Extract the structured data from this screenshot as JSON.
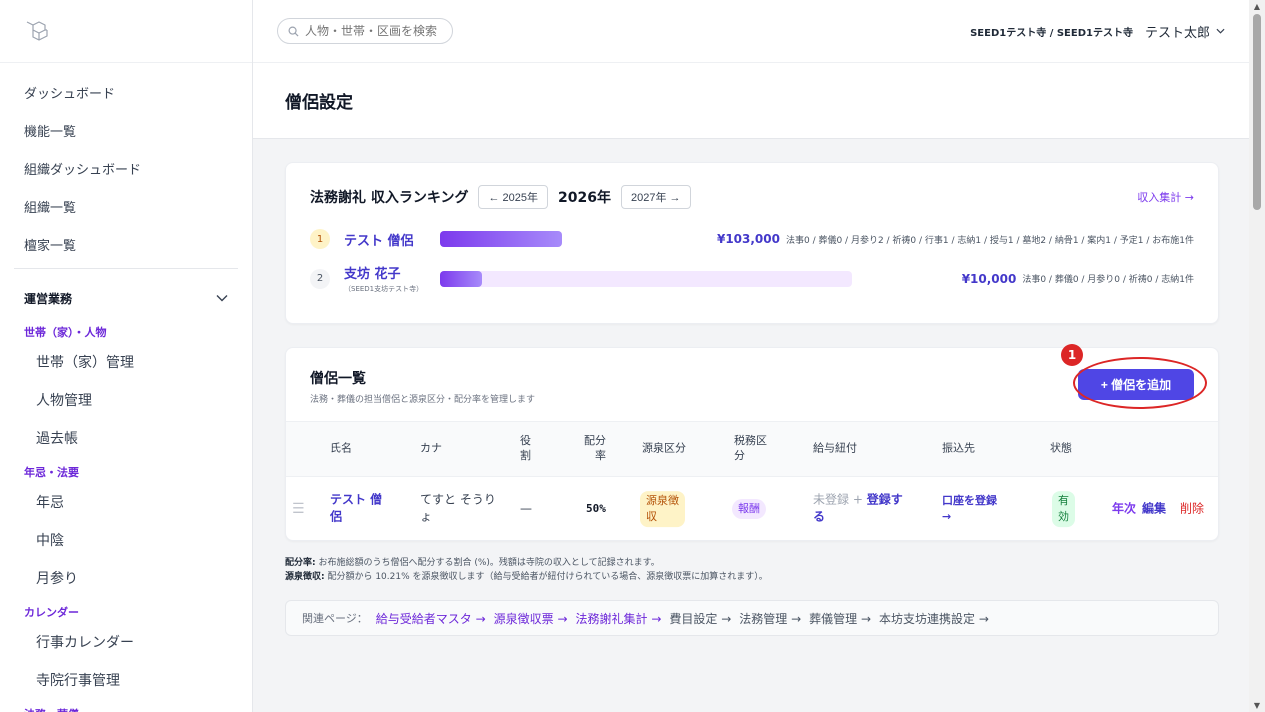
{
  "sidebar": {
    "nav": [
      "ダッシュボード",
      "機能一覧",
      "組織ダッシュボード",
      "組織一覧",
      "檀家一覧"
    ],
    "section": "運営業務",
    "groups": [
      {
        "title": "世帯（家）・人物",
        "items": [
          "世帯（家）管理",
          "人物管理",
          "過去帳"
        ]
      },
      {
        "title": "年忌・法要",
        "items": [
          "年忌",
          "中陰",
          "月参り"
        ]
      },
      {
        "title": "カレンダー",
        "items": [
          "行事カレンダー",
          "寺院行事管理"
        ]
      }
    ],
    "cut_group": "法務・葬儀"
  },
  "header": {
    "search_placeholder": "人物・世帯・区画を検索",
    "org": "SEED1テスト寺 / SEED1テスト寺",
    "user": "テスト太郎"
  },
  "page": {
    "title": "僧侶設定"
  },
  "ranking": {
    "title": "法務謝礼 収入ランキング",
    "prev_year": "← 2025年",
    "current_year": "2026年",
    "next_year": "2027年 →",
    "link": "収入集計 →",
    "rows": [
      {
        "rank": "1",
        "name": "テスト 僧侶",
        "sub": "",
        "amount": "¥103,000",
        "ratio": 1.0,
        "detail": "法事0 / 葬儀0 / 月参り2 / 祈祷0 / 行事1 / 志納1 / 授与1 / 墓地2 / 納骨1 / 案内1 / 予定1 / お布施1件"
      },
      {
        "rank": "2",
        "name": "支坊 花子",
        "sub": "（SEED1支坊テスト寺）",
        "amount": "¥10,000",
        "ratio": 0.097,
        "detail": "法事0 / 葬儀0 / 月参り0 / 祈祷0 / 志納1件"
      }
    ]
  },
  "list": {
    "title": "僧侶一覧",
    "subtitle": "法務・葬儀の担当僧侶と源泉区分・配分率を管理します",
    "add_button": "+ 僧侶を追加",
    "marker": "1",
    "headers": {
      "name": "氏名",
      "kana": "カナ",
      "role": "役\n割",
      "ratio": "配分\n率",
      "withholding": "源泉区分",
      "tax": "税務区\n分",
      "salary": "給与紐付",
      "bank": "振込先",
      "status": "状態"
    },
    "row": {
      "drag": "☰",
      "name": "テスト 僧\n侶",
      "kana": "てすと そうり\nょ",
      "role": "—",
      "ratio": "50%",
      "withholding": "源泉徴\n収",
      "tax": "報酬",
      "salary_status": "未登録",
      "salary_sep": " + ",
      "salary_link": "登録す\nる",
      "bank": "口座を登録\n→",
      "status": "有\n効",
      "action_annual": "年次",
      "action_edit": "編集",
      "action_delete": "削除"
    }
  },
  "notes": {
    "ratio_label": "配分率:",
    "ratio_text": " お布施総額のうち僧侶へ配分する割合 (%)。残額は寺院の収入として記録されます。",
    "withholding_label": "源泉徴収:",
    "withholding_text": " 配分額から 10.21% を源泉徴収します（給与受給者が紐付けられている場合、源泉徴収票に加算されます）。"
  },
  "related": {
    "label": "関連ページ：",
    "links": [
      {
        "text": "給与受給者マスタ →",
        "style": "accent"
      },
      {
        "text": "源泉徴収票 →",
        "style": "accent"
      },
      {
        "text": "法務謝礼集計 →",
        "style": "accent"
      },
      {
        "text": "費目設定 →",
        "style": "plain"
      },
      {
        "text": "法務管理 →",
        "style": "plain"
      },
      {
        "text": "葬儀管理 →",
        "style": "plain"
      },
      {
        "text": "本坊支坊連携設定 →",
        "style": "plain"
      }
    ]
  },
  "colors": {
    "accent": "#4f46e5",
    "purple": "#7c3aed",
    "highlight": "#dc2626"
  }
}
